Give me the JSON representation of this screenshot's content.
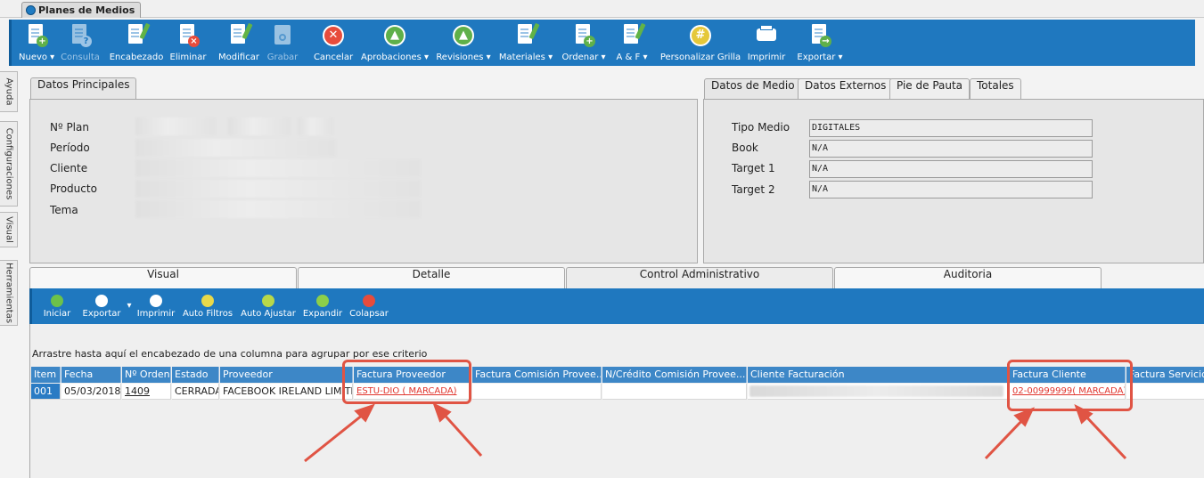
{
  "window_tab": {
    "title": "Planes de Medios"
  },
  "toolbar": {
    "buttons": [
      {
        "id": "nuevo",
        "label": "Nuevo",
        "icon": "doc-add-icon",
        "dropdown": true,
        "disabled": false
      },
      {
        "id": "consulta",
        "label": "Consulta",
        "icon": "doc-query-icon",
        "dropdown": false,
        "disabled": true
      },
      {
        "id": "encabezado",
        "label": "Encabezado",
        "icon": "doc-edit-icon",
        "dropdown": false,
        "disabled": false
      },
      {
        "id": "eliminar",
        "label": "Eliminar",
        "icon": "doc-delete-icon",
        "dropdown": false,
        "disabled": false
      },
      {
        "id": "modificar",
        "label": "Modificar",
        "icon": "doc-edit-icon",
        "dropdown": false,
        "disabled": false
      },
      {
        "id": "grabar",
        "label": "Grabar",
        "icon": "save-icon",
        "dropdown": false,
        "disabled": true
      },
      {
        "id": "cancelar",
        "label": "Cancelar",
        "icon": "cancel-icon",
        "dropdown": false,
        "disabled": false
      },
      {
        "id": "aprobaciones",
        "label": "Aprobaciones",
        "icon": "thumbs-up-icon",
        "dropdown": true,
        "disabled": false
      },
      {
        "id": "revisiones",
        "label": "Revisiones",
        "icon": "thumbs-up-icon",
        "dropdown": true,
        "disabled": false
      },
      {
        "id": "materiales",
        "label": "Materiales",
        "icon": "doc-edit-icon",
        "dropdown": true,
        "disabled": false
      },
      {
        "id": "ordenar",
        "label": "Ordenar",
        "icon": "doc-add-icon",
        "dropdown": true,
        "disabled": false
      },
      {
        "id": "ayf",
        "label": "A & F",
        "icon": "doc-edit-icon",
        "dropdown": true,
        "disabled": false
      },
      {
        "id": "personalizar",
        "label": "Personalizar Grilla",
        "icon": "grid-icon",
        "dropdown": false,
        "disabled": false
      },
      {
        "id": "imprimir",
        "label": "Imprimir",
        "icon": "printer-icon",
        "dropdown": false,
        "disabled": false
      },
      {
        "id": "exportar",
        "label": "Exportar",
        "icon": "export-icon",
        "dropdown": true,
        "disabled": false
      }
    ]
  },
  "side_tabs": [
    "Ayuda",
    "Configuraciones",
    "Visual",
    "Herramientas"
  ],
  "datos_principales": {
    "tab": "Datos Principales",
    "labels": [
      "Nº Plan",
      "Período",
      "Cliente",
      "Producto",
      "Tema"
    ]
  },
  "datos_medio": {
    "tabs": [
      "Datos de Medio",
      "Datos Externos",
      "Pie de Pauta",
      "Totales"
    ],
    "fields": [
      {
        "label": "Tipo Medio",
        "value": "DIGITALES"
      },
      {
        "label": "Book",
        "value": "N/A"
      },
      {
        "label": "Target 1",
        "value": "N/A"
      },
      {
        "label": "Target 2",
        "value": "N/A"
      }
    ]
  },
  "bottom_tabs": [
    "Visual",
    "Detalle",
    "Control Administrativo",
    "Auditoria"
  ],
  "sub_toolbar": {
    "buttons": [
      {
        "label": "Iniciar",
        "icon": "play-icon",
        "color": "#6cc24a"
      },
      {
        "label": "Exportar",
        "icon": "export-icon",
        "color": "#ffffff"
      },
      {
        "label": "Imprimir",
        "icon": "printer-icon",
        "color": "#ffffff"
      },
      {
        "label": "Auto Filtros",
        "icon": "filter-icon",
        "color": "#e8d94a"
      },
      {
        "label": "Auto Ajustar",
        "icon": "resize-icon",
        "color": "#b7d84a"
      },
      {
        "label": "Expandir",
        "icon": "expand-icon",
        "color": "#8ccf4a"
      },
      {
        "label": "Colapsar",
        "icon": "collapse-icon",
        "color": "#e74c3c"
      }
    ]
  },
  "grid": {
    "group_hint": "Arrastre hasta aquí el encabezado de una columna para agrupar por ese criterio",
    "columns": [
      "Item",
      "Fecha",
      "Nº Orden",
      "Estado",
      "Proveedor",
      "Factura Proveedor",
      "Factura Comisión Provee...",
      "N/Crédito Comisión Provee...",
      "Cliente Facturación",
      "Factura Cliente",
      "Factura Servicio"
    ],
    "row": [
      "001",
      "05/03/2018",
      "1409",
      "CERRADA",
      "FACEBOOK IRELAND LIMITED",
      "ESTU-DIO      ( MARCADA)",
      "",
      "",
      "",
      "02-00999999( MARCADA)",
      ""
    ]
  },
  "colors": {
    "toolbar": "#1f78bf",
    "header": "#3d87c7",
    "annotation": "#e05444",
    "link": "#e0342c"
  }
}
